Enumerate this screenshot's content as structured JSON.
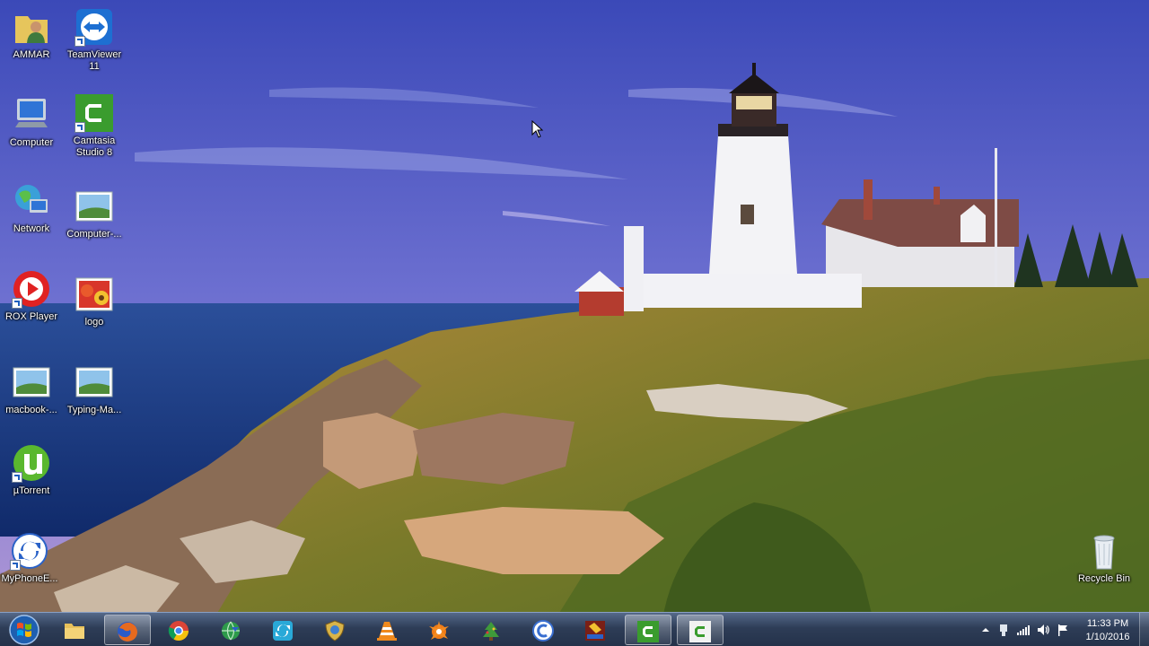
{
  "desktop": {
    "icons": [
      {
        "label": "AMMAR",
        "icon": "user-folder-icon"
      },
      {
        "label": "TeamViewer 11",
        "icon": "teamviewer-icon"
      },
      {
        "label": "Computer",
        "icon": "computer-icon"
      },
      {
        "label": "Camtasia Studio 8",
        "icon": "camtasia-icon"
      },
      {
        "label": "Network",
        "icon": "network-icon"
      },
      {
        "label": "Computer-...",
        "icon": "image-file-icon"
      },
      {
        "label": "ROX Player",
        "icon": "rox-player-icon"
      },
      {
        "label": "logo",
        "icon": "image-file-icon"
      },
      {
        "label": "macbook-...",
        "icon": "image-file-icon"
      },
      {
        "label": "Typing-Ma...",
        "icon": "image-file-icon"
      },
      {
        "label": "µTorrent",
        "icon": "utorrent-icon"
      },
      {
        "label": "MyPhoneE...",
        "icon": "sync-icon"
      },
      {
        "label": "Recycle Bin",
        "icon": "recycle-bin-icon"
      }
    ]
  },
  "taskbar": {
    "pinned": [
      {
        "name": "file-explorer",
        "icon": "folder-icon"
      },
      {
        "name": "firefox",
        "icon": "firefox-icon"
      },
      {
        "name": "chrome",
        "icon": "chrome-icon"
      },
      {
        "name": "internet-download",
        "icon": "globe-icon"
      },
      {
        "name": "sync-app",
        "icon": "sync-icon"
      },
      {
        "name": "security",
        "icon": "shield-icon"
      },
      {
        "name": "vlc",
        "icon": "vlc-cone-icon"
      },
      {
        "name": "avast",
        "icon": "avast-icon"
      },
      {
        "name": "app-tree",
        "icon": "tree-icon"
      },
      {
        "name": "ccleaner",
        "icon": "ccleaner-icon"
      },
      {
        "name": "inpage",
        "icon": "inpage-icon"
      },
      {
        "name": "camtasia-recorder",
        "icon": "camtasia-icon"
      },
      {
        "name": "camtasia-studio",
        "icon": "camtasia-icon"
      }
    ],
    "clock": {
      "time": "11:33 PM",
      "date": "1/10/2016"
    }
  },
  "colors": {
    "taskbar": "#2e3d57",
    "camtasia": "#3a9c2e",
    "sky": "#4a5db5",
    "sea": "#1d3f8a"
  }
}
